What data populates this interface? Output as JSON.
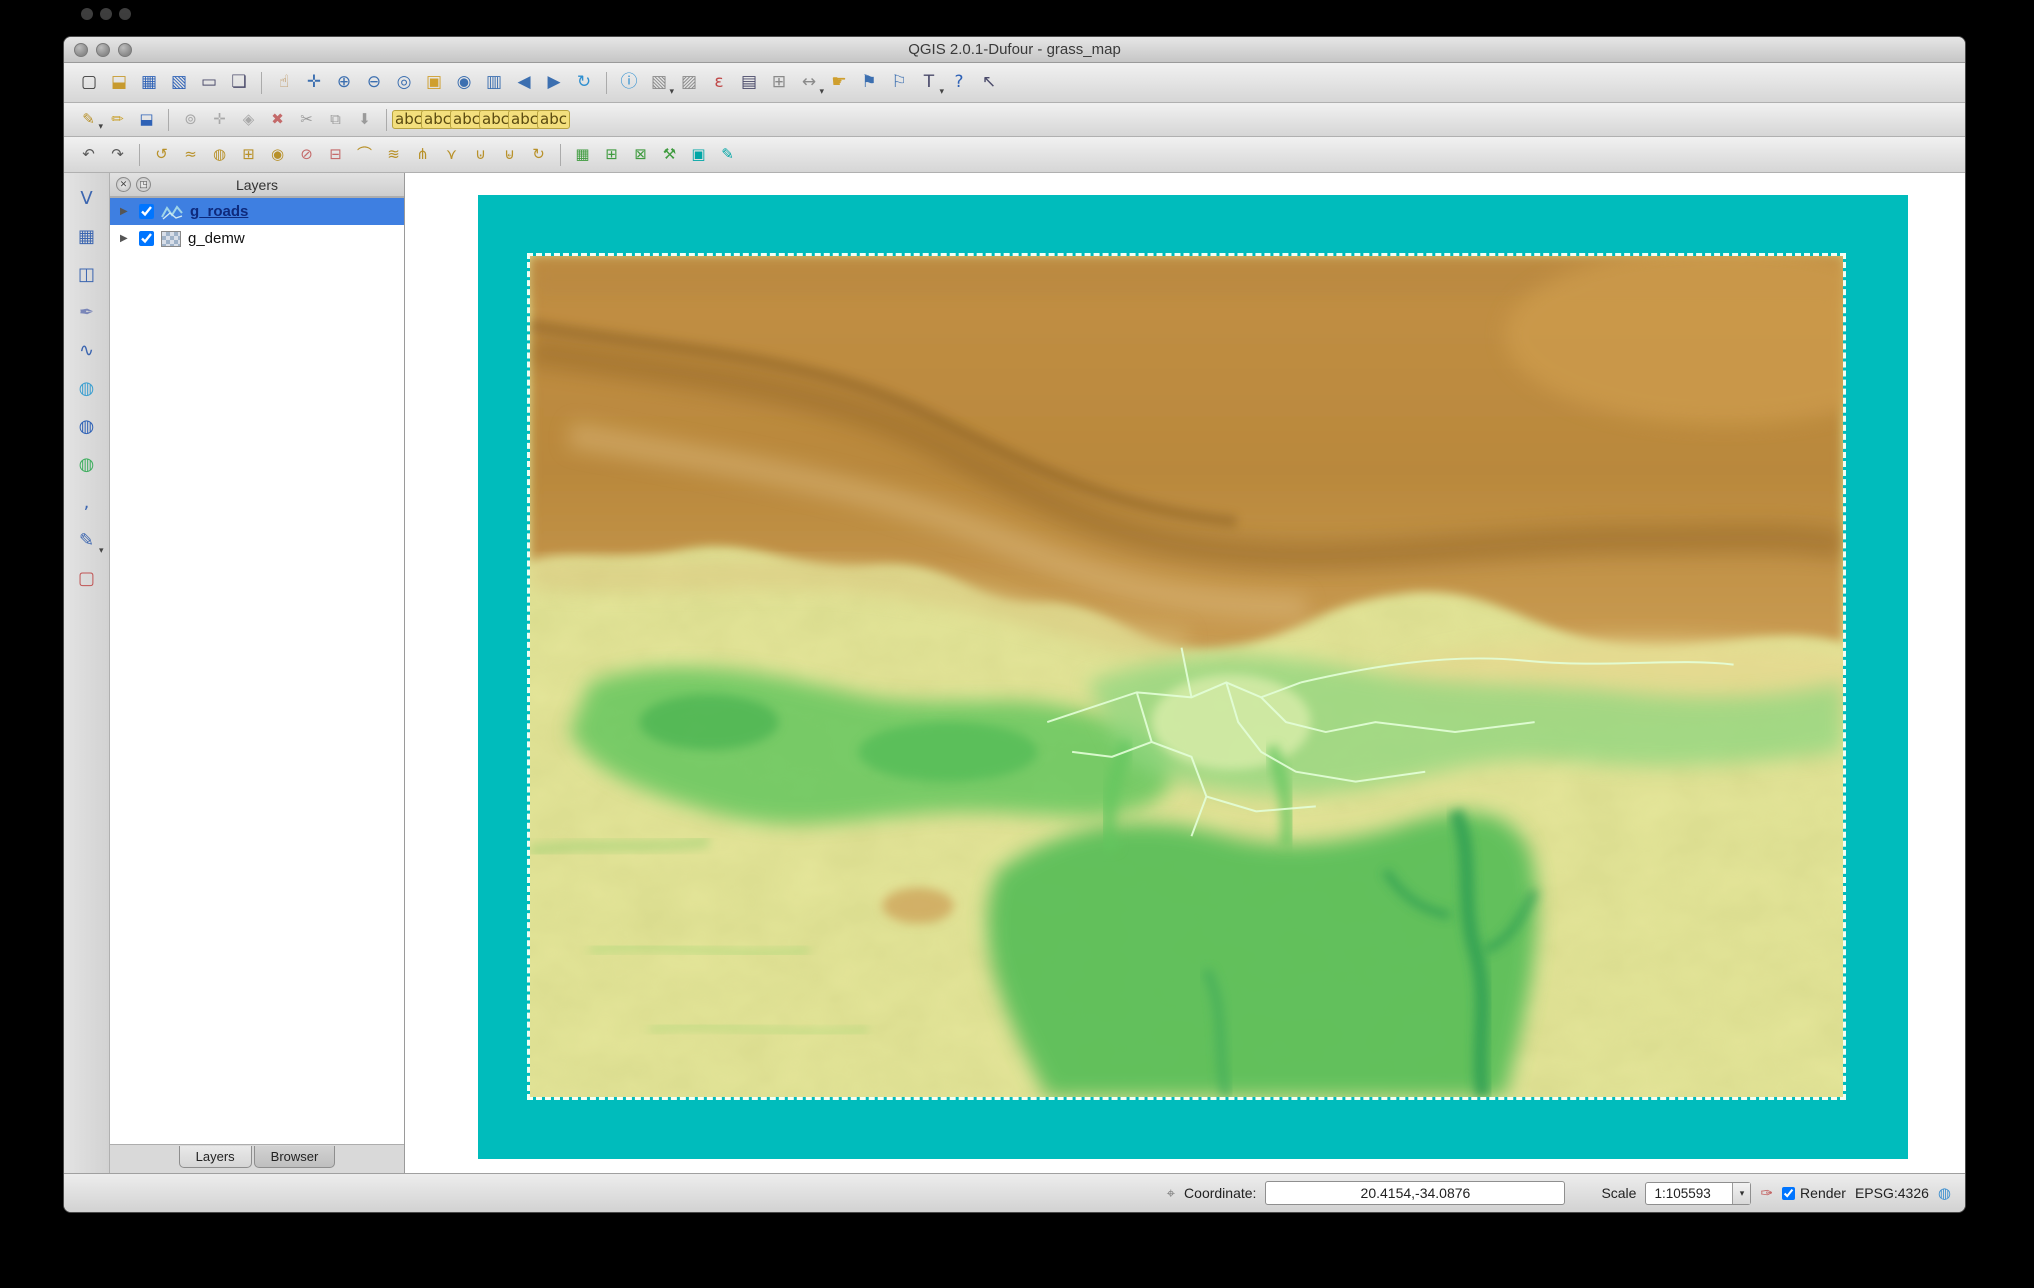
{
  "window": {
    "title": "QGIS 2.0.1-Dufour - grass_map"
  },
  "titlebar": {
    "buttons": [
      "close",
      "minimize",
      "zoom"
    ]
  },
  "toolbars": {
    "row1": [
      {
        "name": "new-project",
        "glyph": "▢",
        "color": "#3a3a3a"
      },
      {
        "name": "open-project",
        "glyph": "⬓",
        "color": "#c79a2e"
      },
      {
        "name": "save-project",
        "glyph": "▦",
        "color": "#2f62b6"
      },
      {
        "name": "save-project-as",
        "glyph": "▧",
        "color": "#2f62b6"
      },
      {
        "name": "new-print-composer",
        "glyph": "▭",
        "color": "#4a4a6a"
      },
      {
        "name": "composer-manager",
        "glyph": "❏",
        "color": "#4a4a6a"
      },
      {
        "sep": true
      },
      {
        "name": "pan-map",
        "glyph": "☝",
        "color": "#b98e54"
      },
      {
        "name": "pan-to-selection",
        "glyph": "✛",
        "color": "#3c6fb0"
      },
      {
        "name": "zoom-in",
        "glyph": "⊕",
        "color": "#3c6fb0"
      },
      {
        "name": "zoom-out",
        "glyph": "⊖",
        "color": "#3c6fb0"
      },
      {
        "name": "zoom-actual",
        "glyph": "◎",
        "color": "#3c6fb0"
      },
      {
        "name": "zoom-full",
        "glyph": "▣",
        "color": "#cf9f2e"
      },
      {
        "name": "zoom-to-selection",
        "glyph": "◉",
        "color": "#3c6fb0"
      },
      {
        "name": "zoom-to-layer",
        "glyph": "▥",
        "color": "#3c6fb0"
      },
      {
        "name": "zoom-last",
        "glyph": "◀",
        "color": "#3c6fb0"
      },
      {
        "name": "zoom-next",
        "glyph": "▶",
        "color": "#3c6fb0"
      },
      {
        "name": "refresh-map",
        "glyph": "↻",
        "color": "#2f8fd0"
      },
      {
        "sep": true
      },
      {
        "name": "identify-features",
        "glyph": "ⓘ",
        "color": "#2f8fd0"
      },
      {
        "name": "select-features",
        "glyph": "▧",
        "color": "#8a8a8a",
        "menu": true
      },
      {
        "name": "deselect-features",
        "glyph": "▨",
        "color": "#8a8a8a"
      },
      {
        "name": "select-by-expression",
        "glyph": "ε",
        "color": "#c04848"
      },
      {
        "name": "open-attribute-table",
        "glyph": "▤",
        "color": "#4a4a6a"
      },
      {
        "name": "field-calculator",
        "glyph": "⊞",
        "color": "#8a8a8a"
      },
      {
        "name": "measure",
        "glyph": "↔",
        "color": "#8a8a8a",
        "menu": true
      },
      {
        "name": "map-tips",
        "glyph": "☛",
        "color": "#cf9f2e"
      },
      {
        "name": "new-bookmark",
        "glyph": "⚑",
        "color": "#3c6fb0"
      },
      {
        "name": "show-bookmarks",
        "glyph": "⚐",
        "color": "#3c6fb0"
      },
      {
        "name": "text-annotation",
        "glyph": "T",
        "color": "#4a4a6a",
        "menu": true
      },
      {
        "name": "help-contents",
        "glyph": "?",
        "color": "#2f62b6"
      },
      {
        "name": "whats-this",
        "glyph": "↖",
        "color": "#4a4a6a"
      }
    ],
    "row2": [
      {
        "name": "current-edits",
        "glyph": "✎",
        "color": "#b8912a",
        "menu": true
      },
      {
        "name": "toggle-editing",
        "glyph": "✏",
        "color": "#caa22f"
      },
      {
        "name": "save-layer-edits",
        "glyph": "⬓",
        "color": "#2f62b6"
      },
      {
        "sep": true
      },
      {
        "name": "add-feature",
        "glyph": "⊚",
        "color": "#a8a8a8"
      },
      {
        "name": "move-feature",
        "glyph": "✛",
        "color": "#a8a8a8"
      },
      {
        "name": "node-tool",
        "glyph": "◈",
        "color": "#a8a8a8"
      },
      {
        "name": "delete-selected",
        "glyph": "✖",
        "color": "#c46a6a"
      },
      {
        "name": "cut-features",
        "glyph": "✂",
        "color": "#9a9a9a"
      },
      {
        "name": "copy-features",
        "glyph": "⧉",
        "color": "#9a9a9a"
      },
      {
        "name": "paste-features",
        "glyph": "⬇",
        "color": "#9a9a9a"
      },
      {
        "sep": true
      },
      {
        "name": "labeling",
        "glyph": "abc",
        "color": "#5a4a10",
        "small": true
      },
      {
        "name": "pin-labels",
        "glyph": "abc",
        "color": "#5a4a10",
        "small": true
      },
      {
        "name": "highlight-labels",
        "glyph": "abc",
        "color": "#5a4a10",
        "small": true
      },
      {
        "name": "move-label",
        "glyph": "abc",
        "color": "#5a4a10",
        "small": true
      },
      {
        "name": "rotate-label",
        "glyph": "abc",
        "color": "#5a4a10",
        "small": true
      },
      {
        "name": "change-label",
        "glyph": "abc",
        "color": "#5a4a10",
        "small": true
      }
    ],
    "row3": [
      {
        "name": "undo",
        "glyph": "↶",
        "color": "#5a5a5a"
      },
      {
        "name": "redo",
        "glyph": "↷",
        "color": "#5a5a5a"
      },
      {
        "sep": true
      },
      {
        "name": "rotate-feature",
        "glyph": "↺",
        "color": "#b8912a"
      },
      {
        "name": "simplify-feature",
        "glyph": "≈",
        "color": "#b8912a"
      },
      {
        "name": "add-ring",
        "glyph": "◍",
        "color": "#b8912a"
      },
      {
        "name": "add-part",
        "glyph": "⊞",
        "color": "#b8912a"
      },
      {
        "name": "fill-ring",
        "glyph": "◉",
        "color": "#b8912a"
      },
      {
        "name": "delete-ring",
        "glyph": "⊘",
        "color": "#c46a6a"
      },
      {
        "name": "delete-part",
        "glyph": "⊟",
        "color": "#c46a6a"
      },
      {
        "name": "reshape-features",
        "glyph": "⌒",
        "color": "#b8912a"
      },
      {
        "name": "offset-curve",
        "glyph": "≋",
        "color": "#b8912a"
      },
      {
        "name": "split-features",
        "glyph": "⋔",
        "color": "#b8912a"
      },
      {
        "name": "split-parts",
        "glyph": "⋎",
        "color": "#b8912a"
      },
      {
        "name": "merge-features",
        "glyph": "⊍",
        "color": "#b8912a"
      },
      {
        "name": "merge-attributes",
        "glyph": "⊌",
        "color": "#b8912a"
      },
      {
        "name": "rotate-point-symbols",
        "glyph": "↻",
        "color": "#b8912a"
      },
      {
        "sep": true
      },
      {
        "name": "grass-open-mapset",
        "glyph": "▦",
        "color": "#3f9b3f"
      },
      {
        "name": "grass-new-mapset",
        "glyph": "⊞",
        "color": "#3f9b3f"
      },
      {
        "name": "grass-close-mapset",
        "glyph": "⊠",
        "color": "#3f9b3f"
      },
      {
        "name": "grass-tools",
        "glyph": "⚒",
        "color": "#3f9b3f"
      },
      {
        "name": "grass-display-region",
        "glyph": "▣",
        "color": "#00a6a6"
      },
      {
        "name": "grass-edit-region",
        "glyph": "✎",
        "color": "#00a6a6"
      }
    ],
    "layers_strip": [
      {
        "name": "add-vector-layer",
        "glyph": "V",
        "color": "#3c66b0"
      },
      {
        "name": "add-raster-layer",
        "glyph": "▦",
        "color": "#3c66b0"
      },
      {
        "name": "add-postgis-layer",
        "glyph": "◫",
        "color": "#3c66b0"
      },
      {
        "name": "add-spatialite-layer",
        "glyph": "✒",
        "color": "#7a86b8"
      },
      {
        "name": "add-mssql-layer",
        "glyph": "∿",
        "color": "#3c66b0"
      },
      {
        "name": "add-wms-layer",
        "glyph": "◍",
        "color": "#3c9fd0"
      },
      {
        "name": "add-wcs-layer",
        "glyph": "◍",
        "color": "#2f62b6"
      },
      {
        "name": "add-wfs-layer",
        "glyph": "◍",
        "color": "#3fae5f"
      },
      {
        "name": "add-delimited-text-layer",
        "glyph": ",",
        "color": "#3c66b0"
      },
      {
        "name": "new-shapefile-layer",
        "glyph": "✎",
        "color": "#3c66b0",
        "menu": true
      },
      {
        "name": "new-spatialite-layer",
        "glyph": "▢",
        "color": "#c05555"
      }
    ]
  },
  "panels": {
    "layers": {
      "title": "Layers",
      "rows": [
        {
          "label": "g_roads",
          "checked": true,
          "selected": true,
          "geometry": "line"
        },
        {
          "label": "g_demw",
          "checked": true,
          "selected": false,
          "geometry": "raster"
        }
      ],
      "tabs": [
        {
          "label": "Layers",
          "active": true
        },
        {
          "label": "Browser",
          "active": false
        }
      ]
    }
  },
  "statusbar": {
    "coordinate_label": "Coordinate:",
    "coordinate_value": "20.4154,-34.0876",
    "scale_label": "Scale",
    "scale_value": "1:105593",
    "render_label": "Render",
    "render_checked": true,
    "crs_label": "EPSG:4326"
  },
  "map": {
    "colors": {
      "region_fill": "#00bcbc",
      "terrain_base": "#e6e79b",
      "mountain_brown": "#bb883c",
      "valley_green": "#54bd57",
      "river_green": "#2f9e52",
      "roads": "#e4ffd9"
    }
  }
}
